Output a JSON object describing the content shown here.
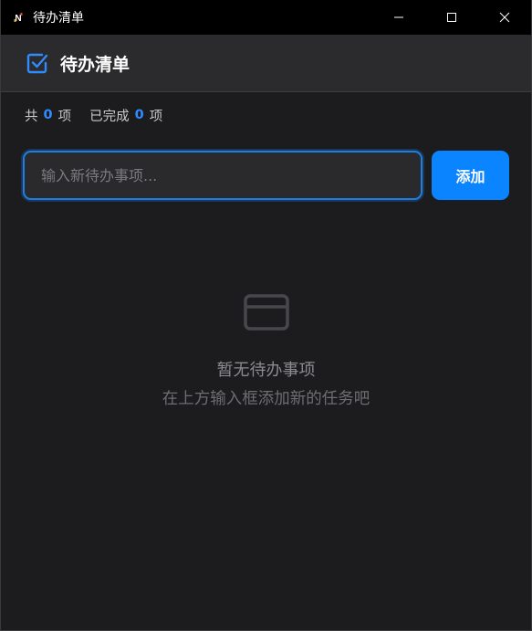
{
  "window": {
    "title": "待办清单",
    "app_icon": "notion-n-icon"
  },
  "header": {
    "title": "待办清单",
    "icon": "checkbox-icon"
  },
  "stats": {
    "total_prefix": "共",
    "total_count": "0",
    "total_suffix": "项",
    "done_prefix": "已完成",
    "done_count": "0",
    "done_suffix": "项"
  },
  "input": {
    "placeholder": "输入新待办事项...",
    "value": ""
  },
  "add_button": {
    "label": "添加"
  },
  "empty_state": {
    "icon": "card-icon",
    "title": "暂无待办事项",
    "subtitle": "在上方输入框添加新的任务吧"
  },
  "colors": {
    "accent": "#0a84ff",
    "background": "#1c1c1e",
    "header_bg": "#2b2b2d",
    "titlebar_bg": "#000000"
  }
}
